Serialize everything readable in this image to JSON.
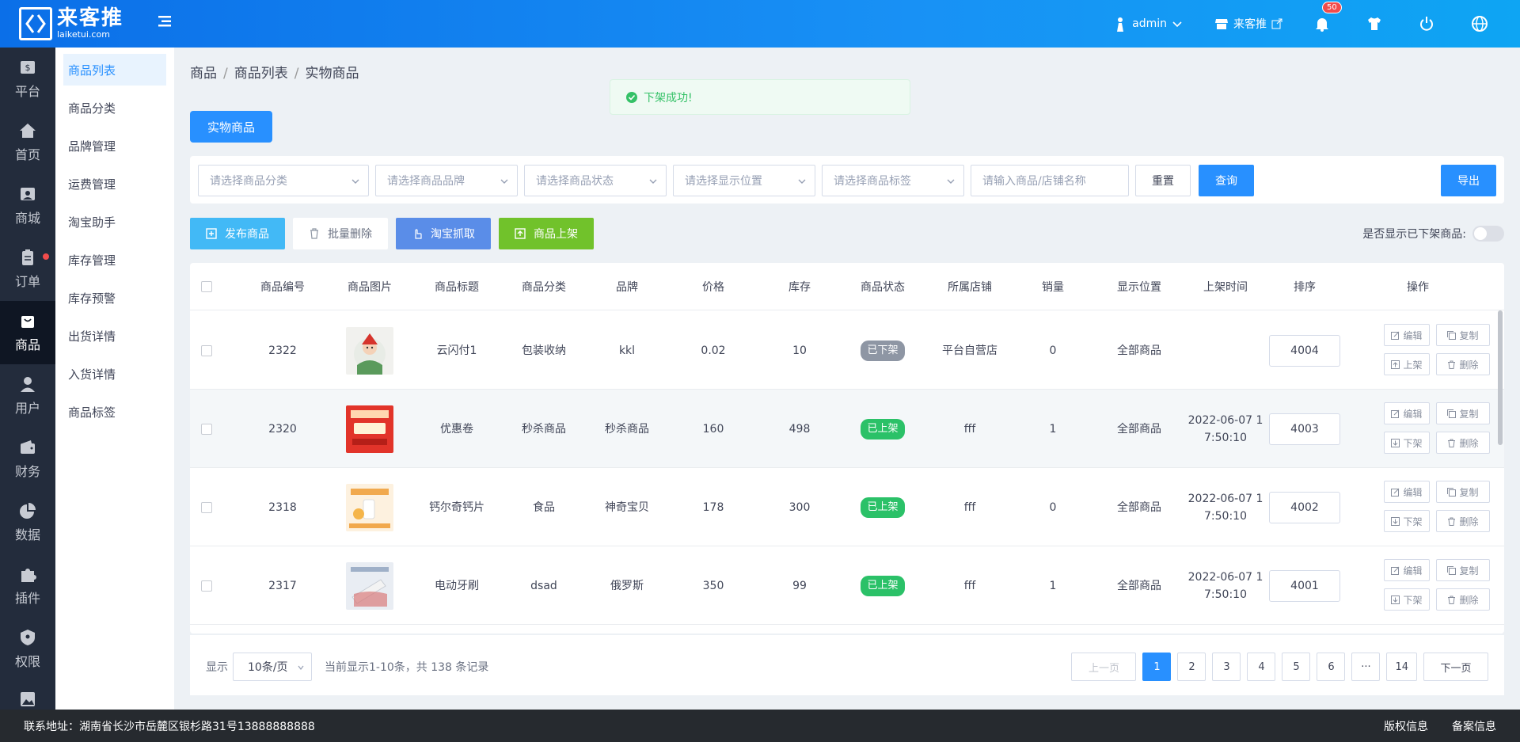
{
  "brand": {
    "name_cn": "来客推",
    "name_en": "laiketui.com"
  },
  "topbar": {
    "user": "admin",
    "store": "来客推",
    "notifications": "50"
  },
  "sidebar": {
    "items": [
      {
        "label": "平台",
        "icon": "dollar-icon"
      },
      {
        "label": "首页",
        "icon": "home-icon"
      },
      {
        "label": "商城",
        "icon": "shop-icon"
      },
      {
        "label": "订单",
        "icon": "clipboard-icon"
      },
      {
        "label": "商品",
        "icon": "bag-icon"
      },
      {
        "label": "用户",
        "icon": "user-icon"
      },
      {
        "label": "财务",
        "icon": "wallet-icon"
      },
      {
        "label": "数据",
        "icon": "pie-icon"
      },
      {
        "label": "插件",
        "icon": "puzzle-icon"
      },
      {
        "label": "权限",
        "icon": "shield-icon"
      }
    ]
  },
  "submenu": {
    "items": [
      "商品列表",
      "商品分类",
      "品牌管理",
      "运费管理",
      "淘宝助手",
      "库存管理",
      "库存预警",
      "出货详情",
      "入货详情",
      "商品标签"
    ]
  },
  "breadcrumb": [
    "商品",
    "商品列表",
    "实物商品"
  ],
  "toast": "下架成功!",
  "tab": "实物商品",
  "filters": {
    "category": "请选择商品分类",
    "brand": "请选择商品品牌",
    "status": "请选择商品状态",
    "position": "请选择显示位置",
    "tag": "请选择商品标签",
    "search": "请输入商品/店铺名称",
    "reset": "重置",
    "query": "查询",
    "export": "导出"
  },
  "actions": {
    "publish": "发布商品",
    "batch_delete": "批量删除",
    "taobao": "淘宝抓取",
    "shelve": "商品上架",
    "show_off_label": "是否显示已下架商品:"
  },
  "table": {
    "headers": [
      "商品编号",
      "商品图片",
      "商品标题",
      "商品分类",
      "品牌",
      "价格",
      "库存",
      "商品状态",
      "所属店铺",
      "销量",
      "显示位置",
      "上架时间",
      "排序",
      "操作"
    ],
    "rows": [
      {
        "id": "2322",
        "title": "云闪付1",
        "category": "包装收纳",
        "brand": "kkl",
        "price": "0.02",
        "stock": "10",
        "status": "已下架",
        "shop": "平台自营店",
        "sales": "0",
        "position": "全部商品",
        "time": "",
        "sort": "4004",
        "toggle": "上架"
      },
      {
        "id": "2320",
        "title": "优惠卷",
        "category": "秒杀商品",
        "brand": "秒杀商品",
        "price": "160",
        "stock": "498",
        "status": "已上架",
        "shop": "fff",
        "sales": "1",
        "position": "全部商品",
        "time": "2022-06-07 1\n7:50:10",
        "sort": "4003",
        "toggle": "下架"
      },
      {
        "id": "2318",
        "title": "钙尔奇钙片",
        "category": "食品",
        "brand": "神奇宝贝",
        "price": "178",
        "stock": "300",
        "status": "已上架",
        "shop": "fff",
        "sales": "0",
        "position": "全部商品",
        "time": "2022-06-07 1\n7:50:10",
        "sort": "4002",
        "toggle": "下架"
      },
      {
        "id": "2317",
        "title": "电动牙刷",
        "category": "dsad",
        "brand": "俄罗斯",
        "price": "350",
        "stock": "99",
        "status": "已上架",
        "shop": "fff",
        "sales": "1",
        "position": "全部商品",
        "time": "2022-06-07 1\n7:50:10",
        "sort": "4001",
        "toggle": "下架"
      }
    ],
    "op_edit": "编辑",
    "op_copy": "复制",
    "op_delete": "删除"
  },
  "pagination": {
    "show_label": "显示",
    "page_size": "10条/页",
    "summary": "当前显示1-10条，共 138 条记录",
    "prev": "上一页",
    "pages": [
      "1",
      "2",
      "3",
      "4",
      "5",
      "6",
      "···",
      "14"
    ],
    "next": "下一页"
  },
  "footer": {
    "address": "联系地址：湖南省长沙市岳麓区银杉路31号13888888888",
    "copyright": "版权信息",
    "record": "备案信息"
  },
  "colors": {
    "primary": "#2890ff",
    "success": "#2bc168",
    "offline": "#8e96a4",
    "cyan": "#42b9f6",
    "indigo": "#5a8de8",
    "green": "#71c22b"
  }
}
